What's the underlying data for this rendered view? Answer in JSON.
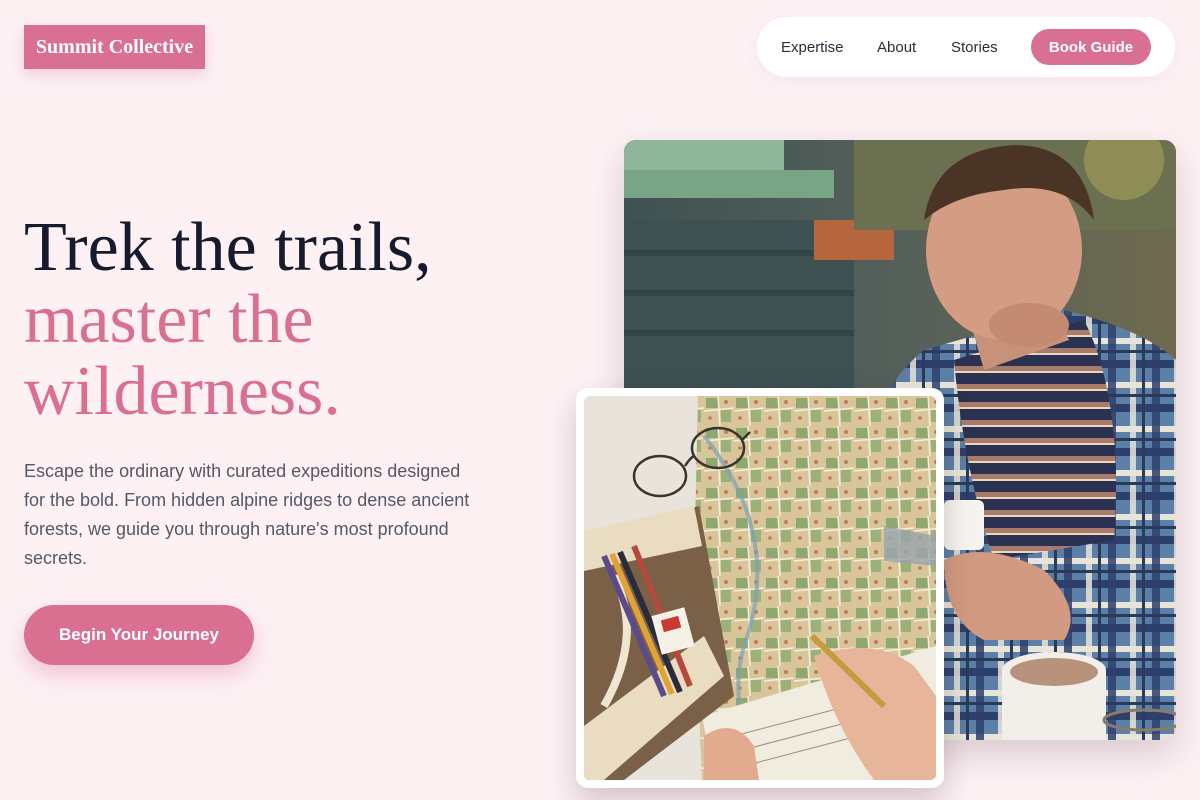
{
  "brand": {
    "name": "Summit Collective"
  },
  "nav": {
    "links": [
      "Expertise",
      "About",
      "Stories"
    ],
    "cta": "Book Guide"
  },
  "hero": {
    "headline_line1": "Trek the trails,",
    "headline_line2": "master the",
    "headline_line3": "wilderness.",
    "description": "Escape the ordinary with curated expeditions designed for the bold. From hidden alpine ridges to dense ancient forests, we guide you through nature's most profound secrets.",
    "cta": "Begin Your Journey"
  },
  "colors": {
    "background": "#fdf1f4",
    "accent": "#d97092",
    "heading": "#161a2c",
    "body_text": "#555866"
  }
}
